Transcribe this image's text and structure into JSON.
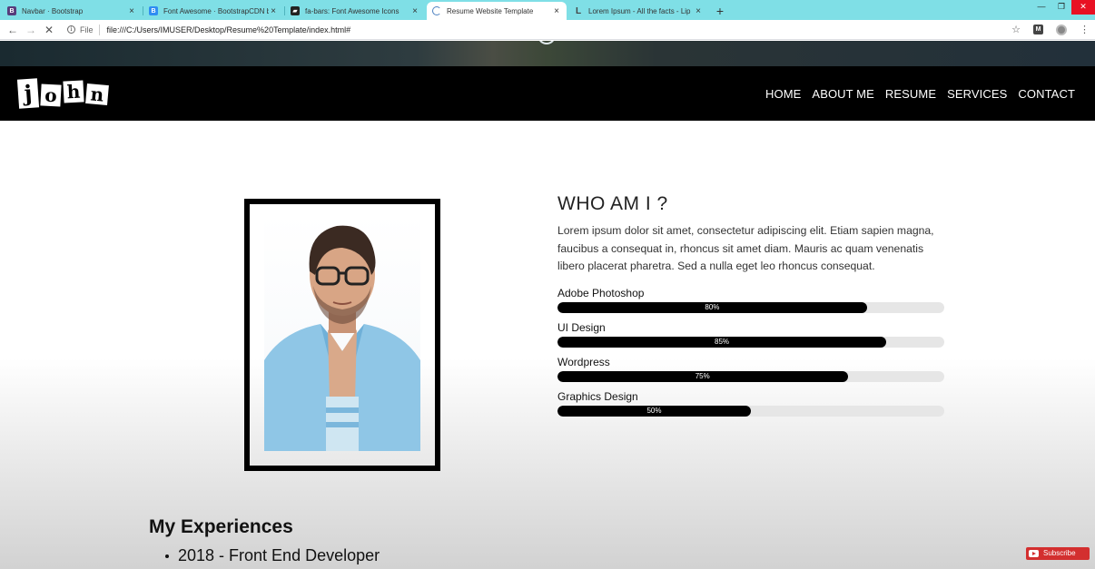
{
  "browser": {
    "tabs": [
      {
        "title": "Navbar · Bootstrap",
        "favicon": "B",
        "favicon_color": "#563d7c",
        "active": false
      },
      {
        "title": "Font Awesome · BootstrapCDN b",
        "favicon": "B",
        "favicon_color": "#2f8cf2",
        "active": false
      },
      {
        "title": "fa-bars: Font Awesome Icons",
        "favicon": "▰",
        "favicon_color": "#222222",
        "active": false
      },
      {
        "title": "Resume Website Template",
        "favicon": "loading-spinner-icon",
        "favicon_color": "#4a7fc0",
        "active": true
      },
      {
        "title": "Lorem Ipsum - All the facts - Lip",
        "favicon": "L",
        "favicon_color": "#444444",
        "active": false
      }
    ],
    "file_label": "File",
    "url": "file:///C:/Users/IMUSER/Desktop/Resume%20Template/index.html#"
  },
  "site": {
    "logo_letters": [
      "j",
      "o",
      "h",
      "n"
    ],
    "nav": [
      "HOME",
      "ABOUT ME",
      "RESUME",
      "SERVICES",
      "CONTACT"
    ]
  },
  "about": {
    "title": "WHO AM I ?",
    "text": "Lorem ipsum dolor sit amet, consectetur adipiscing elit. Etiam sapien magna, faucibus a consequat in, rhoncus sit amet diam. Mauris ac quam venenatis libero placerat pharetra. Sed a nulla eget leo rhoncus consequat.",
    "skills": [
      {
        "name": "Adobe Photoshop",
        "percent": 80,
        "label": "80%"
      },
      {
        "name": "UI Design",
        "percent": 85,
        "label": "85%"
      },
      {
        "name": "Wordpress",
        "percent": 75,
        "label": "75%"
      },
      {
        "name": "Graphics Design",
        "percent": 50,
        "label": "50%"
      }
    ]
  },
  "experience": {
    "title": "My Experiences",
    "items": [
      "2018 - Front End Developer"
    ]
  },
  "overlay": {
    "subscribe_label": "Subscribe"
  },
  "colors": {
    "tabbar": "#7fdfe6",
    "navbar": "#000000",
    "skill_fill": "#000000",
    "skill_track": "#e6e6e6"
  }
}
